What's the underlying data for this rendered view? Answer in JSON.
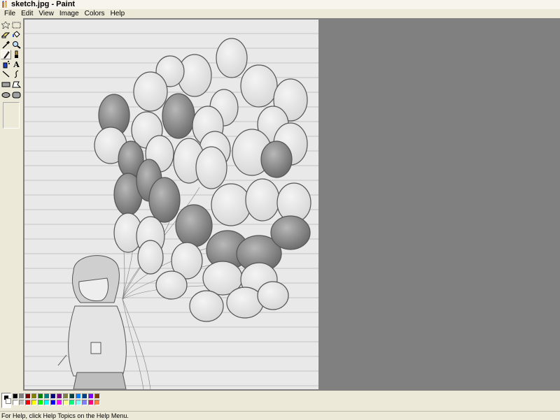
{
  "window": {
    "title": "sketch.jpg - Paint",
    "icon": "paint-app-icon"
  },
  "menu": {
    "items": [
      "File",
      "Edit",
      "View",
      "Image",
      "Colors",
      "Help"
    ]
  },
  "toolbox": {
    "tools": [
      {
        "name": "free-form-select-icon"
      },
      {
        "name": "select-icon"
      },
      {
        "name": "eraser-icon"
      },
      {
        "name": "fill-bucket-icon"
      },
      {
        "name": "pick-color-icon"
      },
      {
        "name": "magnifier-icon"
      },
      {
        "name": "pencil-icon",
        "selected": true
      },
      {
        "name": "brush-icon"
      },
      {
        "name": "airbrush-icon"
      },
      {
        "name": "text-icon"
      },
      {
        "name": "line-icon"
      },
      {
        "name": "curve-icon"
      },
      {
        "name": "rectangle-icon"
      },
      {
        "name": "polygon-icon"
      },
      {
        "name": "ellipse-icon"
      },
      {
        "name": "rounded-rectangle-icon"
      }
    ],
    "text_tool_glyph": "A"
  },
  "canvas": {
    "image": "pencil sketch on lined paper"
  },
  "colors": {
    "foreground": "#000000",
    "background": "#ffffff",
    "palette": [
      "#000000",
      "#808080",
      "#800000",
      "#808000",
      "#008000",
      "#008080",
      "#000080",
      "#800080",
      "#808040",
      "#004040",
      "#0080ff",
      "#004080",
      "#8000ff",
      "#804000",
      "#ffffff",
      "#c0c0c0",
      "#ff0000",
      "#ffff00",
      "#00ff00",
      "#00ffff",
      "#0000ff",
      "#ff00ff",
      "#ffff80",
      "#00ff80",
      "#80ffff",
      "#8080ff",
      "#ff0080",
      "#ff8040"
    ]
  },
  "status": {
    "text": "For Help, click Help Topics on the Help Menu."
  }
}
